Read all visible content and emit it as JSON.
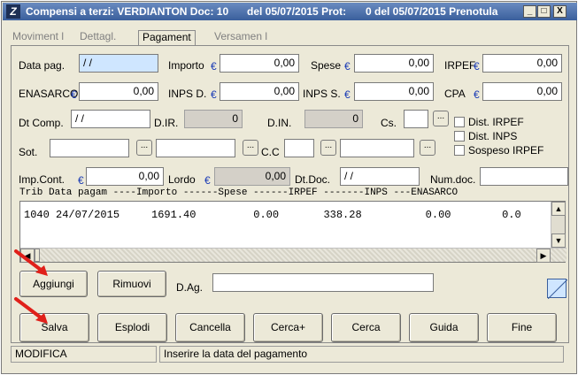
{
  "window": {
    "title_part1": "Compensi a terzi: VERDIANTON Doc: 10",
    "title_part2": "del 05/07/2015 Prot:",
    "title_part3": "0 del 05/07/2015 Prenotula",
    "minimize": "_",
    "maximize": "□",
    "close": "X"
  },
  "tabs": [
    {
      "label": "Moviment l"
    },
    {
      "label": "Dettagl."
    },
    {
      "label": "Pagament"
    },
    {
      "label": "Versamen l"
    }
  ],
  "form": {
    "data_pag_label": "Data pag.",
    "data_pag_value": "  /   /",
    "importo_label": "Importo",
    "importo_value": "0,00",
    "spese_label": "Spese",
    "spese_value": "0,00",
    "irpef_label": "IRPEF",
    "irpef_value": "0,00",
    "enasarco_label": "ENASARCO",
    "enasarco_value": "0,00",
    "inpsd_label": "INPS D.",
    "inpsd_value": "0,00",
    "inpss_label": "INPS S.",
    "inpss_value": "0,00",
    "cpa_label": "CPA",
    "cpa_value": "0,00",
    "dtcomp_label": "Dt Comp.",
    "dtcomp_value": "  /   /",
    "dir_label": "D.IR.",
    "dir_value": "0",
    "din_label": "D.IN.",
    "din_value": "0",
    "cs_label": "Cs.",
    "sot_label": "Sot.",
    "cc_label": "C.C",
    "dist_irpef_label": "Dist. IRPEF",
    "dist_inps_label": "Dist. INPS",
    "sospeso_irpef_label": "Sospeso IRPEF",
    "impcont_label": "Imp.Cont.",
    "impcont_value": "0,00",
    "lordo_label": "Lordo",
    "lordo_value": "0,00",
    "dtdoc_label": "Dt.Doc.",
    "dtdoc_value": "  /   /",
    "numdoc_label": "Num.doc.",
    "euro": "€",
    "ellipsis": "..."
  },
  "grid": {
    "header": "Trib Data pagam ----Importo ------Spese ------IRPEF -------INPS ---ENASARCO",
    "rows": [
      {
        "text": "1040 24/07/2015     1691.40         0.00       338.28          0.00        0.0"
      }
    ]
  },
  "actions": {
    "aggiungi": "Aggiungi",
    "rimuovi": "Rimuovi",
    "dag_label": "D.Ag.",
    "salva": "Salva",
    "esplodi": "Esplodi",
    "cancella": "Cancella",
    "cerca_plus": "Cerca+",
    "cerca": "Cerca",
    "guida": "Guida",
    "fine": "Fine"
  },
  "status": {
    "mode": "MODIFICA",
    "hint": "Inserire la data del pagamento"
  },
  "colors": {
    "accent_euro": "#1a3bb5",
    "focused_field": "#cfe6ff",
    "arrow_red": "#e0201a"
  }
}
